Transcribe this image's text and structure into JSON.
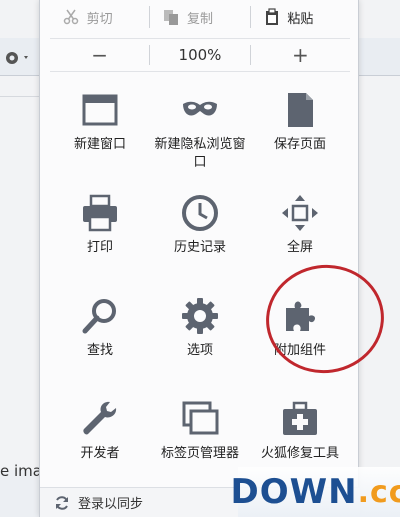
{
  "background": {
    "partial_text": "e imag"
  },
  "edit": {
    "cut_label": "剪切",
    "copy_label": "复制",
    "paste_label": "粘贴"
  },
  "zoom": {
    "minus_label": "−",
    "level": "100%",
    "plus_label": "+"
  },
  "tools": [
    {
      "label": "新建窗口",
      "icon": "new-window-icon"
    },
    {
      "label": "新建隐私浏览窗口",
      "icon": "private-mask-icon"
    },
    {
      "label": "保存页面",
      "icon": "save-page-icon"
    },
    {
      "label": "打印",
      "icon": "printer-icon"
    },
    {
      "label": "历史记录",
      "icon": "history-clock-icon"
    },
    {
      "label": "全屏",
      "icon": "fullscreen-icon"
    },
    {
      "label": "查找",
      "icon": "magnifier-icon"
    },
    {
      "label": "选项",
      "icon": "gear-icon"
    },
    {
      "label": "附加组件",
      "icon": "puzzle-icon"
    },
    {
      "label": "开发者",
      "icon": "wrench-icon"
    },
    {
      "label": "标签页管理器",
      "icon": "tab-manager-icon"
    },
    {
      "label": "火狐修复工具",
      "icon": "first-aid-icon"
    }
  ],
  "footer": {
    "sync_label": "登录以同步"
  },
  "watermark": {
    "text_a": "DOWN",
    "text_b": ".cc"
  },
  "colors": {
    "icon": "#5d6470",
    "highlight": "#c0272d",
    "watermark_blue": "#1d4f92",
    "watermark_orange": "#f19b1e"
  }
}
